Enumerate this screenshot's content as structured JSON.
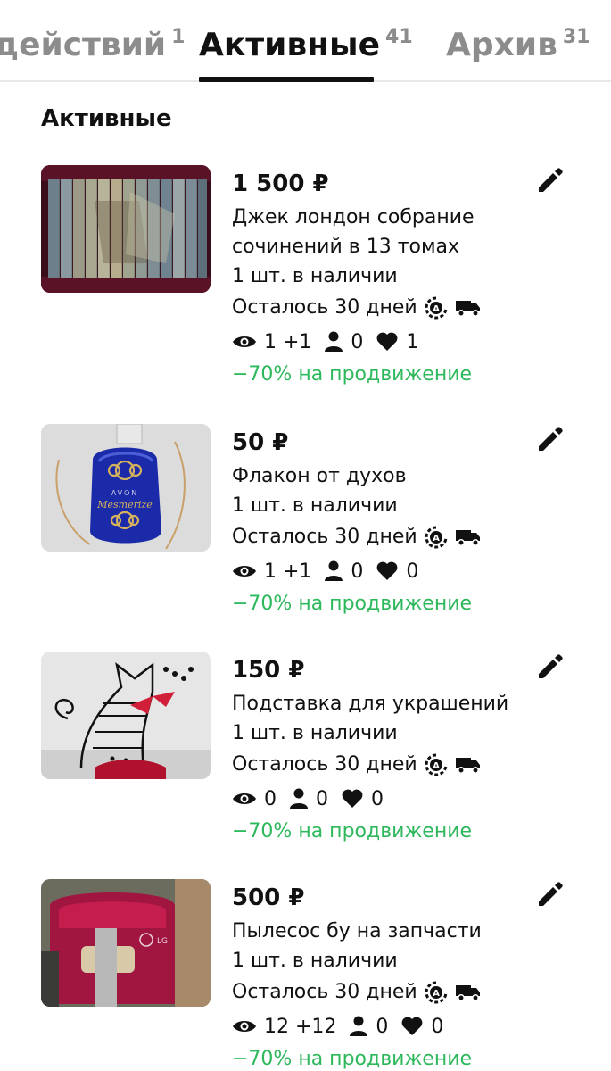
{
  "tabs": [
    {
      "label": "действий",
      "count": "1"
    },
    {
      "label": "Активные",
      "count": "41"
    },
    {
      "label": "Архив",
      "count": "31"
    }
  ],
  "section_title": "Активные",
  "colors": {
    "promo": "#2eb85c",
    "inactive_tab": "#8c8c8c"
  },
  "listings": [
    {
      "price": "1 500 ₽",
      "title": "Джек лондон собрание сочинений в 13 томах",
      "stock": "1 шт. в наличии",
      "days": "Осталось 30 дней",
      "views": "1 +1",
      "contacts": "0",
      "likes": "1",
      "promo": "−70% на продвижение",
      "image_icon": "book-spines-photo"
    },
    {
      "price": "50 ₽",
      "title": "Флакон от духов",
      "stock": "1 шт. в наличии",
      "days": "Осталось 30 дней",
      "views": "1 +1",
      "contacts": "0",
      "likes": "0",
      "promo": "−70% на продвижение",
      "image_icon": "perfume-bottle-photo",
      "image_text": [
        "AVON",
        "Mesmerize"
      ]
    },
    {
      "price": "150 ₽",
      "title": "Подставка для украшений",
      "stock": "1 шт. в наличии",
      "days": "Осталось 30 дней",
      "views": "0",
      "contacts": "0",
      "likes": "0",
      "promo": "−70% на продвижение",
      "image_icon": "cat-jewelry-stand-photo"
    },
    {
      "price": "500 ₽",
      "title": "Пылесос бу на запчасти",
      "stock": "1 шт. в наличии",
      "days": "Осталось 30 дней",
      "views": "12 +12",
      "contacts": "0",
      "likes": "0",
      "promo": "−70% на продвижение",
      "image_icon": "vacuum-cleaner-photo",
      "image_text": [
        "LG"
      ]
    }
  ]
}
